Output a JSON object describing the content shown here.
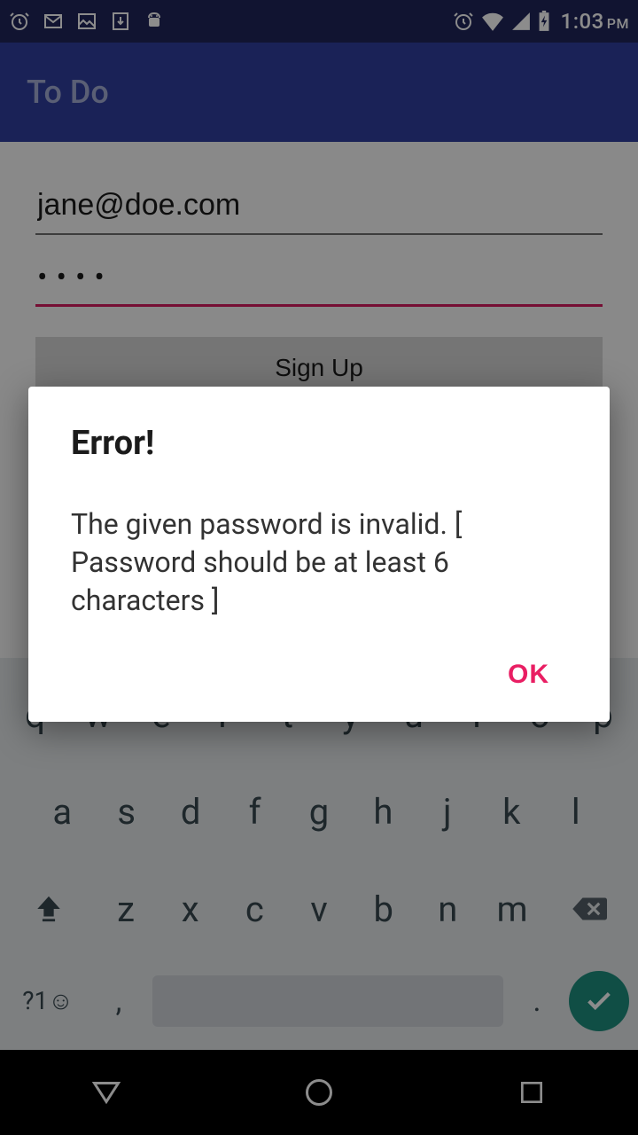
{
  "status_bar": {
    "time": "1:03",
    "period": "PM"
  },
  "app": {
    "title": "To Do"
  },
  "form": {
    "email_value": "jane@doe.com",
    "password_masked": "••••",
    "signup_label": "Sign Up"
  },
  "dialog": {
    "title": "Error!",
    "message": "The given password is invalid. [  Password should be at least 6 characters ]",
    "ok_label": "OK"
  },
  "keyboard": {
    "row1": [
      "q",
      "w",
      "e",
      "r",
      "t",
      "y",
      "u",
      "i",
      "o",
      "p"
    ],
    "row2": [
      "a",
      "s",
      "d",
      "f",
      "g",
      "h",
      "j",
      "k",
      "l"
    ],
    "row3": [
      "z",
      "x",
      "c",
      "v",
      "b",
      "n",
      "m"
    ],
    "symbols_label": "?1☺",
    "comma": ",",
    "period": "."
  }
}
